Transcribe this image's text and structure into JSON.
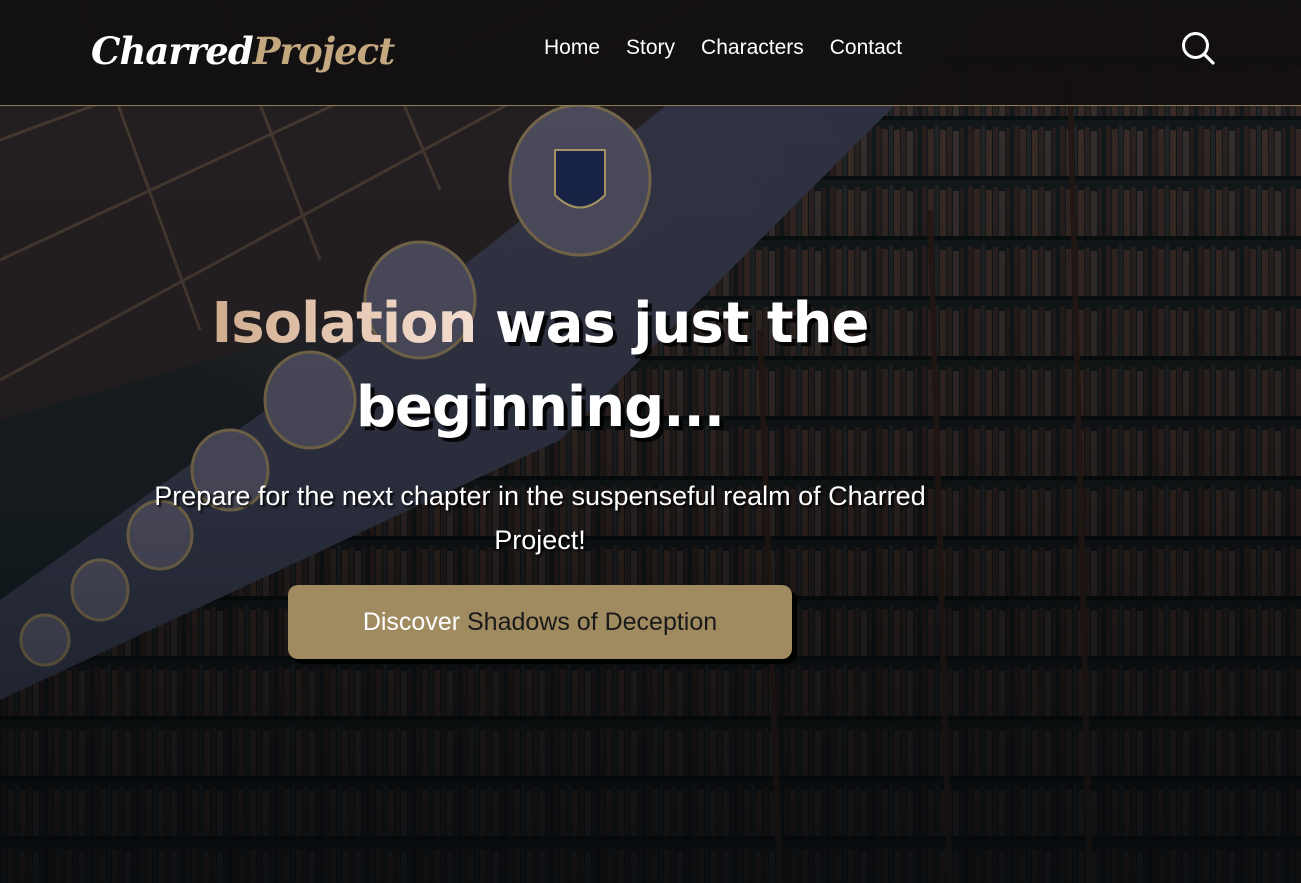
{
  "brand": {
    "logo_part1": "Charred",
    "logo_part2": "Project",
    "accent_color": "#c2a77f",
    "button_color": "#a08a5f"
  },
  "nav": {
    "items": [
      {
        "label": "Home"
      },
      {
        "label": "Story"
      },
      {
        "label": "Characters"
      },
      {
        "label": "Contact"
      }
    ],
    "search_icon": "search-icon"
  },
  "hero": {
    "title_highlight": "Isolation",
    "title_rest": " was just the beginning...",
    "subtitle": "Prepare for the next chapter in the suspenseful realm of Charred Project!",
    "cta_part1": "Discover ",
    "cta_part2": "Shadows of Deception"
  }
}
